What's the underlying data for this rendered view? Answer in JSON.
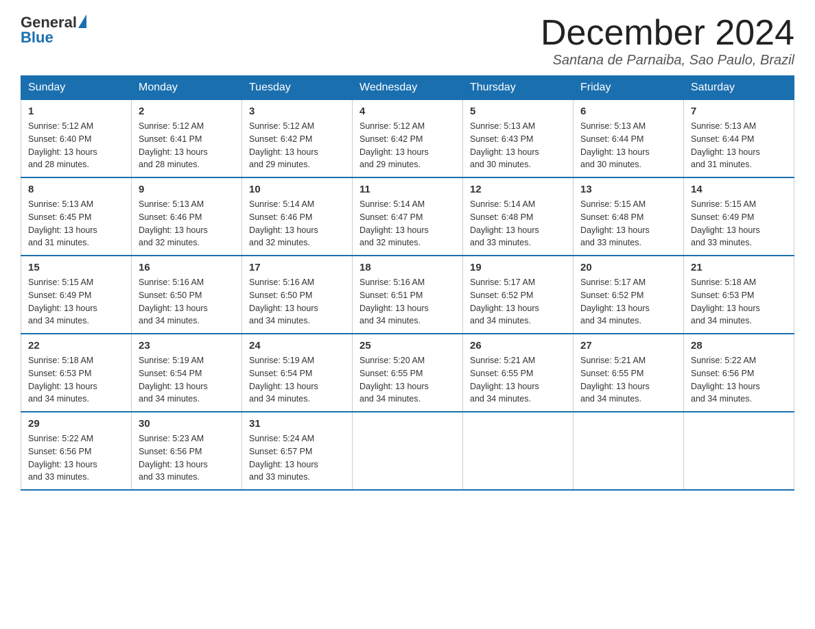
{
  "header": {
    "logo_general": "General",
    "logo_blue": "Blue",
    "title": "December 2024",
    "location": "Santana de Parnaiba, Sao Paulo, Brazil"
  },
  "days_of_week": [
    "Sunday",
    "Monday",
    "Tuesday",
    "Wednesday",
    "Thursday",
    "Friday",
    "Saturday"
  ],
  "weeks": [
    [
      {
        "day": "1",
        "sunrise": "5:12 AM",
        "sunset": "6:40 PM",
        "daylight": "13 hours and 28 minutes."
      },
      {
        "day": "2",
        "sunrise": "5:12 AM",
        "sunset": "6:41 PM",
        "daylight": "13 hours and 28 minutes."
      },
      {
        "day": "3",
        "sunrise": "5:12 AM",
        "sunset": "6:42 PM",
        "daylight": "13 hours and 29 minutes."
      },
      {
        "day": "4",
        "sunrise": "5:12 AM",
        "sunset": "6:42 PM",
        "daylight": "13 hours and 29 minutes."
      },
      {
        "day": "5",
        "sunrise": "5:13 AM",
        "sunset": "6:43 PM",
        "daylight": "13 hours and 30 minutes."
      },
      {
        "day": "6",
        "sunrise": "5:13 AM",
        "sunset": "6:44 PM",
        "daylight": "13 hours and 30 minutes."
      },
      {
        "day": "7",
        "sunrise": "5:13 AM",
        "sunset": "6:44 PM",
        "daylight": "13 hours and 31 minutes."
      }
    ],
    [
      {
        "day": "8",
        "sunrise": "5:13 AM",
        "sunset": "6:45 PM",
        "daylight": "13 hours and 31 minutes."
      },
      {
        "day": "9",
        "sunrise": "5:13 AM",
        "sunset": "6:46 PM",
        "daylight": "13 hours and 32 minutes."
      },
      {
        "day": "10",
        "sunrise": "5:14 AM",
        "sunset": "6:46 PM",
        "daylight": "13 hours and 32 minutes."
      },
      {
        "day": "11",
        "sunrise": "5:14 AM",
        "sunset": "6:47 PM",
        "daylight": "13 hours and 32 minutes."
      },
      {
        "day": "12",
        "sunrise": "5:14 AM",
        "sunset": "6:48 PM",
        "daylight": "13 hours and 33 minutes."
      },
      {
        "day": "13",
        "sunrise": "5:15 AM",
        "sunset": "6:48 PM",
        "daylight": "13 hours and 33 minutes."
      },
      {
        "day": "14",
        "sunrise": "5:15 AM",
        "sunset": "6:49 PM",
        "daylight": "13 hours and 33 minutes."
      }
    ],
    [
      {
        "day": "15",
        "sunrise": "5:15 AM",
        "sunset": "6:49 PM",
        "daylight": "13 hours and 34 minutes."
      },
      {
        "day": "16",
        "sunrise": "5:16 AM",
        "sunset": "6:50 PM",
        "daylight": "13 hours and 34 minutes."
      },
      {
        "day": "17",
        "sunrise": "5:16 AM",
        "sunset": "6:50 PM",
        "daylight": "13 hours and 34 minutes."
      },
      {
        "day": "18",
        "sunrise": "5:16 AM",
        "sunset": "6:51 PM",
        "daylight": "13 hours and 34 minutes."
      },
      {
        "day": "19",
        "sunrise": "5:17 AM",
        "sunset": "6:52 PM",
        "daylight": "13 hours and 34 minutes."
      },
      {
        "day": "20",
        "sunrise": "5:17 AM",
        "sunset": "6:52 PM",
        "daylight": "13 hours and 34 minutes."
      },
      {
        "day": "21",
        "sunrise": "5:18 AM",
        "sunset": "6:53 PM",
        "daylight": "13 hours and 34 minutes."
      }
    ],
    [
      {
        "day": "22",
        "sunrise": "5:18 AM",
        "sunset": "6:53 PM",
        "daylight": "13 hours and 34 minutes."
      },
      {
        "day": "23",
        "sunrise": "5:19 AM",
        "sunset": "6:54 PM",
        "daylight": "13 hours and 34 minutes."
      },
      {
        "day": "24",
        "sunrise": "5:19 AM",
        "sunset": "6:54 PM",
        "daylight": "13 hours and 34 minutes."
      },
      {
        "day": "25",
        "sunrise": "5:20 AM",
        "sunset": "6:55 PM",
        "daylight": "13 hours and 34 minutes."
      },
      {
        "day": "26",
        "sunrise": "5:21 AM",
        "sunset": "6:55 PM",
        "daylight": "13 hours and 34 minutes."
      },
      {
        "day": "27",
        "sunrise": "5:21 AM",
        "sunset": "6:55 PM",
        "daylight": "13 hours and 34 minutes."
      },
      {
        "day": "28",
        "sunrise": "5:22 AM",
        "sunset": "6:56 PM",
        "daylight": "13 hours and 34 minutes."
      }
    ],
    [
      {
        "day": "29",
        "sunrise": "5:22 AM",
        "sunset": "6:56 PM",
        "daylight": "13 hours and 33 minutes."
      },
      {
        "day": "30",
        "sunrise": "5:23 AM",
        "sunset": "6:56 PM",
        "daylight": "13 hours and 33 minutes."
      },
      {
        "day": "31",
        "sunrise": "5:24 AM",
        "sunset": "6:57 PM",
        "daylight": "13 hours and 33 minutes."
      },
      null,
      null,
      null,
      null
    ]
  ],
  "labels": {
    "sunrise": "Sunrise:",
    "sunset": "Sunset:",
    "daylight": "Daylight:"
  }
}
